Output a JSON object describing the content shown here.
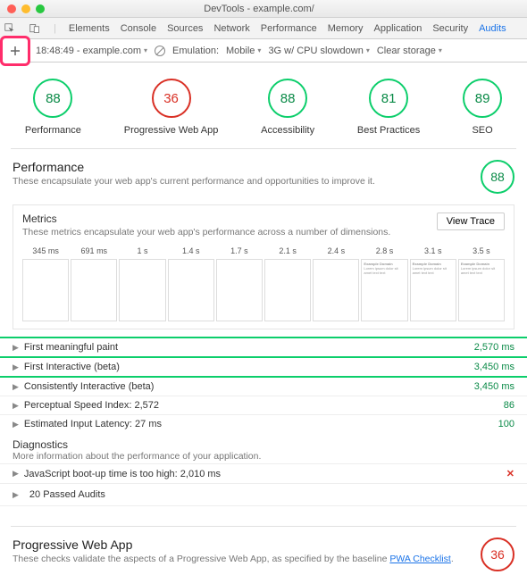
{
  "window": {
    "title": "DevTools - example.com/"
  },
  "tabs": [
    "Elements",
    "Console",
    "Sources",
    "Network",
    "Performance",
    "Memory",
    "Application",
    "Security",
    "Audits"
  ],
  "active_tab": 8,
  "toolbar": {
    "timestamp": "18:48:49 - example.com",
    "emulation_label": "Emulation:",
    "device": "Mobile",
    "network": "3G w/ CPU slowdown",
    "storage": "Clear storage"
  },
  "scores": [
    {
      "label": "Performance",
      "value": "88",
      "band": "green"
    },
    {
      "label": "Progressive Web App",
      "value": "36",
      "band": "red"
    },
    {
      "label": "Accessibility",
      "value": "88",
      "band": "green"
    },
    {
      "label": "Best Practices",
      "value": "81",
      "band": "green"
    },
    {
      "label": "SEO",
      "value": "89",
      "band": "green"
    }
  ],
  "perf_section": {
    "title": "Performance",
    "desc": "These encapsulate your web app's current performance and opportunities to improve it.",
    "score": "88"
  },
  "metrics": {
    "title": "Metrics",
    "desc": "These metrics encapsulate your web app's performance across a number of dimensions.",
    "view_trace": "View Trace",
    "ticks": [
      "345 ms",
      "691 ms",
      "1 s",
      "1.4 s",
      "1.7 s",
      "2.1 s",
      "2.4 s",
      "2.8 s",
      "3.1 s",
      "3.5 s"
    ],
    "filmstrip_text": "Example Domain"
  },
  "metric_rows": [
    {
      "label": "First meaningful paint",
      "value": "2,570 ms",
      "bar": true,
      "vclass": "green"
    },
    {
      "label": "First Interactive (beta)",
      "value": "3,450 ms",
      "bar": true,
      "vclass": "green"
    },
    {
      "label": "Consistently Interactive (beta)",
      "value": "3,450 ms",
      "bar": true,
      "vclass": "green"
    },
    {
      "label": "Perceptual Speed Index: 2,572",
      "value": "86",
      "bar": false,
      "vclass": "green"
    },
    {
      "label": "Estimated Input Latency: 27 ms",
      "value": "100",
      "bar": false,
      "vclass": "green"
    }
  ],
  "diagnostics": {
    "title": "Diagnostics",
    "desc": "More information about the performance of your application.",
    "rows": [
      {
        "label": "JavaScript boot-up time is too high: 2,010 ms",
        "mark": "✕"
      }
    ]
  },
  "passed": {
    "label": "20 Passed Audits"
  },
  "pwa_section": {
    "title": "Progressive Web App",
    "desc_pre": "These checks validate the aspects of a Progressive Web App, as specified by the baseline ",
    "link": "PWA Checklist",
    "desc_post": ".",
    "score": "36"
  }
}
